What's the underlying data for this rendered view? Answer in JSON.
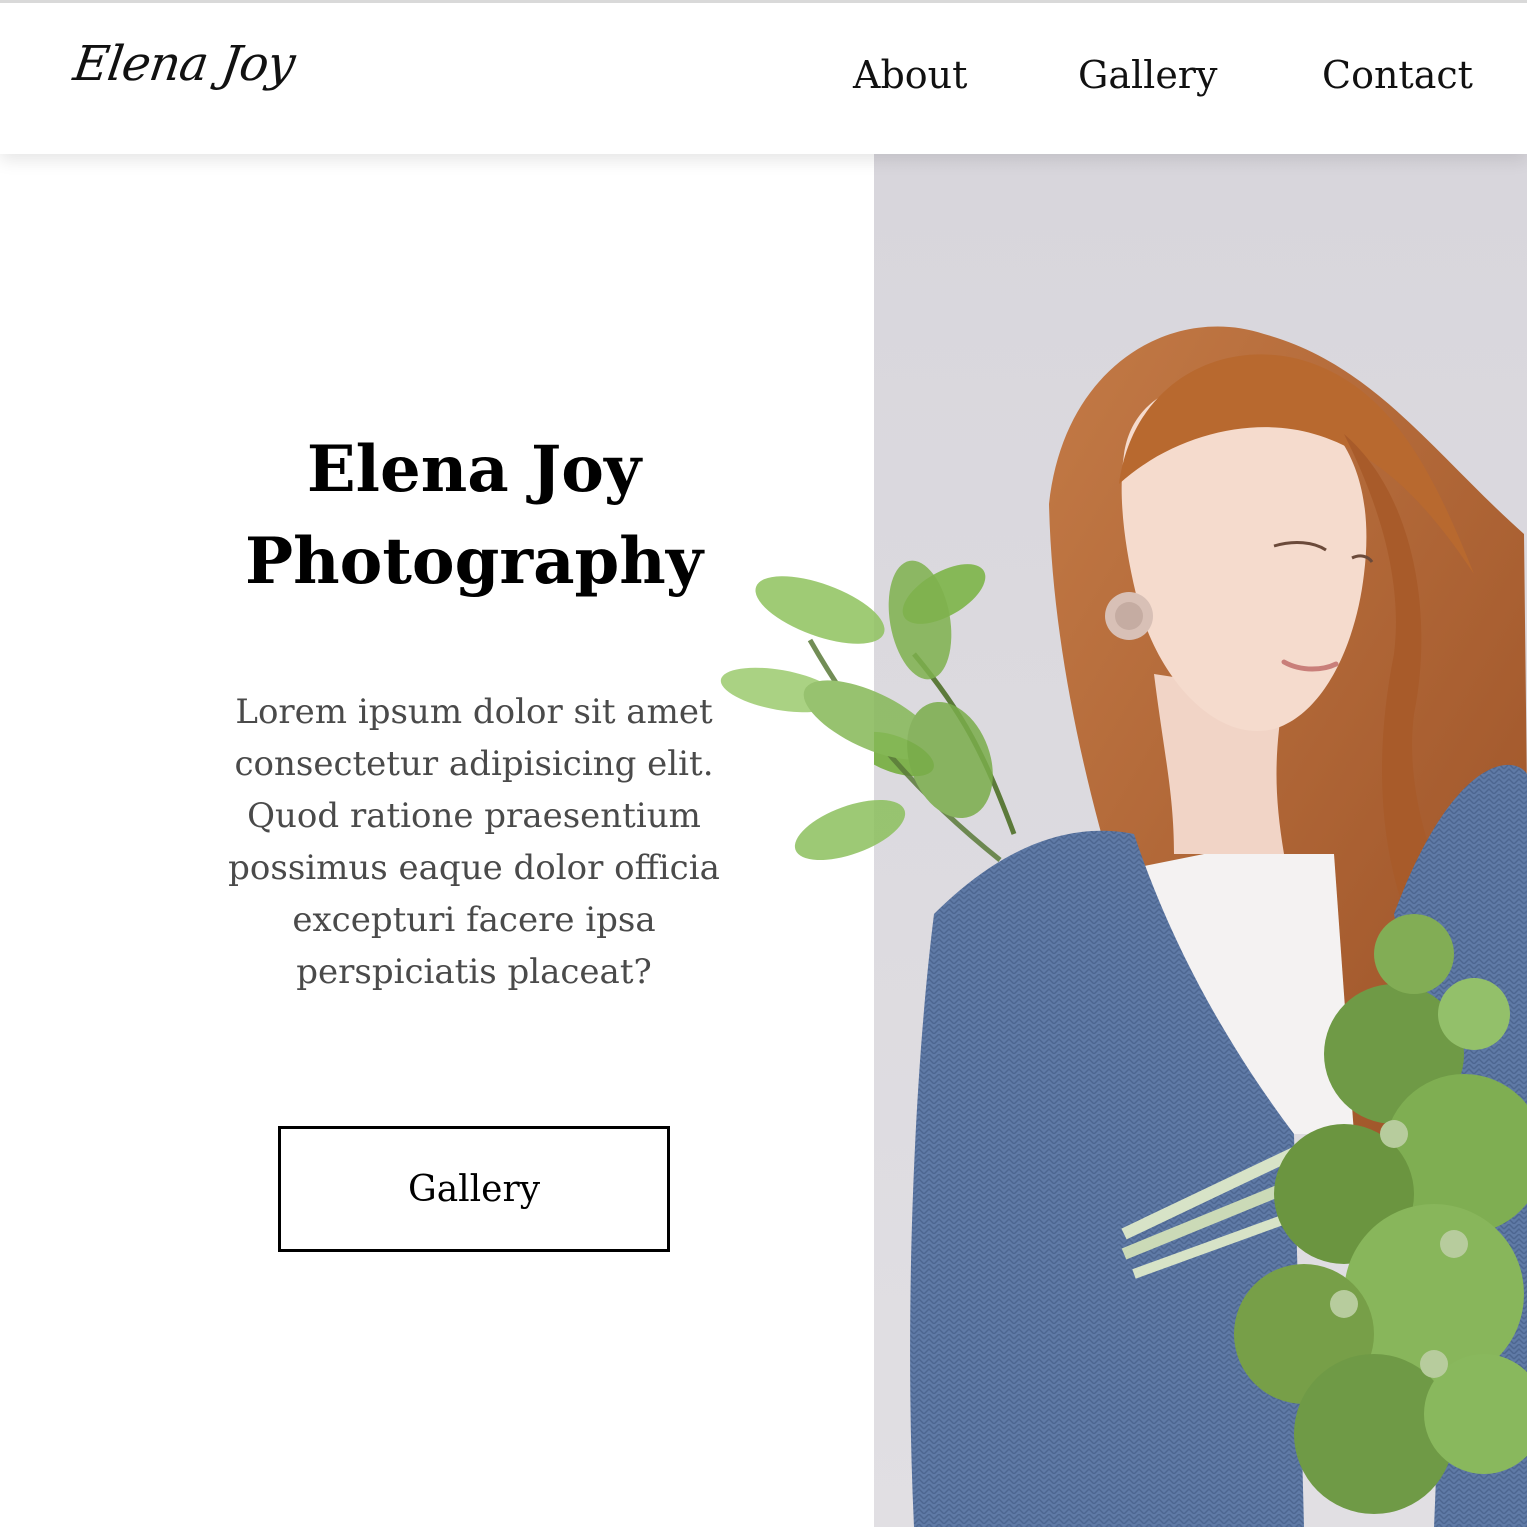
{
  "header": {
    "logo": "Elena Joy",
    "nav": {
      "about": "About",
      "gallery": "Gallery",
      "contact": "Contact"
    }
  },
  "hero": {
    "title_line1": "Elena Joy",
    "title_line2": "Photography",
    "body": "Lorem ipsum dolor sit amet consectetur adipisicing elit. Quod ratione praesentium possimus eaque dolor officia excepturi facere ipsa perspiciatis placeat?",
    "cta_label": "Gallery"
  },
  "colors": {
    "text": "#000000",
    "body_text": "#4a4a4a",
    "photo_background": "#dcdadf",
    "sweater": "#5f7aa6",
    "hair": "#b86a3a",
    "leaf": "#7fb24e"
  }
}
